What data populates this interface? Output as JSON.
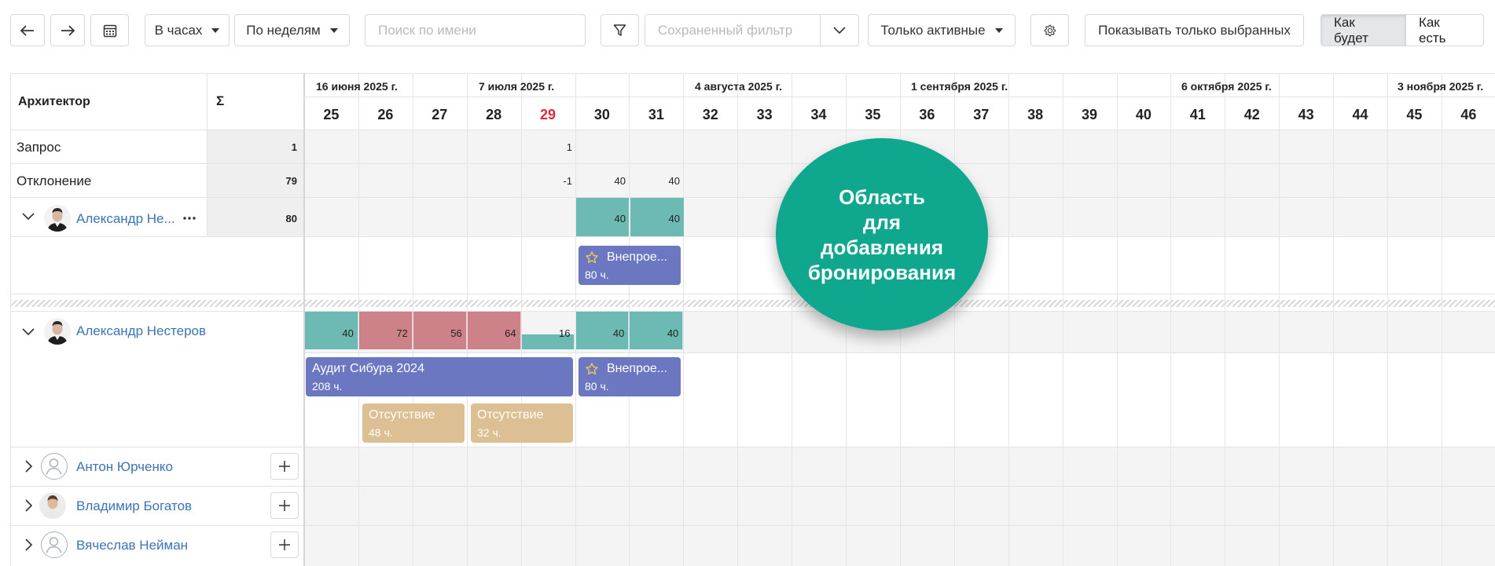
{
  "toolbar": {
    "hours_label": "В часах",
    "period_label": "По неделям",
    "search_placeholder": "Поиск по имени",
    "saved_filter_placeholder": "Сохраненный фильтр",
    "active_label": "Только активные",
    "show_selected_label": "Показывать только выбранных",
    "view_tobe_label": "Как будет",
    "view_asis_label": "Как есть"
  },
  "header": {
    "architect_label": "Архитектор",
    "sigma_label": "Σ",
    "months": [
      "16 июня 2025 г.",
      "7 июля 2025 г.",
      "4 августа 2025 г.",
      "1 сентября 2025 г.",
      "6 октября 2025 г.",
      "3 ноября 2025 г."
    ],
    "weeks": [
      "25",
      "26",
      "27",
      "28",
      "29",
      "30",
      "31",
      "32",
      "33",
      "34",
      "35",
      "36",
      "37",
      "38",
      "39",
      "40",
      "41",
      "42",
      "43",
      "44",
      "45",
      "46"
    ],
    "highlight_week": "29"
  },
  "summary": {
    "request_label": "Запрос",
    "request_total": "1",
    "request_w29": "1",
    "deviation_label": "Отклонение",
    "deviation_total": "79",
    "deviation_w29": "-1",
    "deviation_w30": "40",
    "deviation_w31": "40"
  },
  "booking_row": {
    "person_name": "Александр Не...",
    "total": "80",
    "w30": "40",
    "w31": "40",
    "task_title": "Внепрое...",
    "task_hours": "80 ч."
  },
  "person_main": {
    "name": "Александр Нестеров",
    "loads": [
      "40",
      "72",
      "56",
      "64",
      "16",
      "40",
      "40"
    ],
    "task1_title": "Аудит Сибура 2024",
    "task1_hours": "208 ч.",
    "task2_title": "Внепрое...",
    "task2_hours": "80 ч.",
    "absence1_title": "Отсутствие",
    "absence1_hours": "48 ч.",
    "absence2_title": "Отсутствие",
    "absence2_hours": "32 ч."
  },
  "people": [
    {
      "name": "Антон Юрченко"
    },
    {
      "name": "Владимир Богатов"
    },
    {
      "name": "Вячеслав Нейман"
    }
  ],
  "callout": {
    "line1": "Область",
    "line2": "для",
    "line3": "добавления",
    "line4": "бронирования"
  },
  "colors": {
    "teal": "#6cbab3",
    "red": "#cd8188",
    "blue_task": "#6b78c1",
    "absence": "#dcbf92",
    "callout": "#0fa88f",
    "link": "#3a74b4"
  }
}
